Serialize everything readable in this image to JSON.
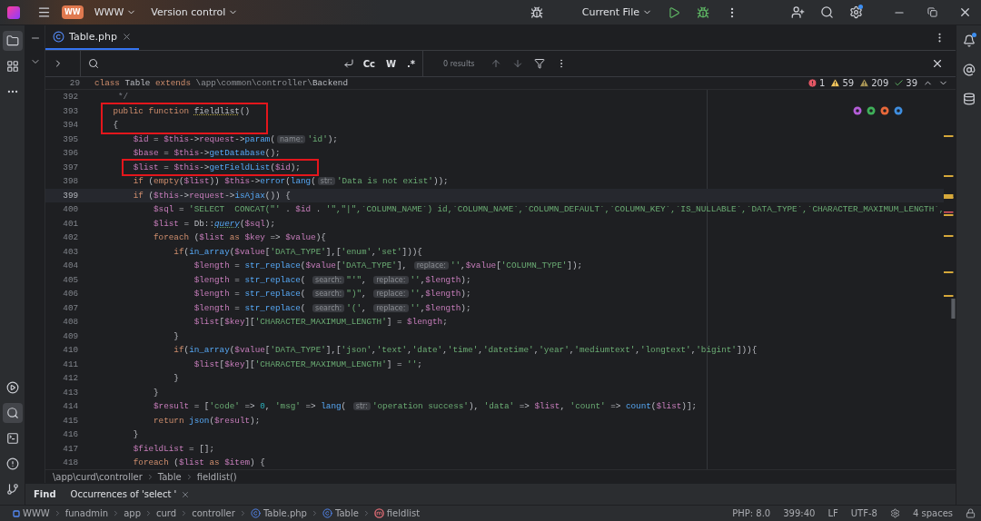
{
  "title_bar": {
    "project_badge": "WW",
    "project": "WWW",
    "vcs": "Version control",
    "run_config": "Current File"
  },
  "left_tools": [
    {
      "kind": "project",
      "selected": true
    },
    {
      "kind": "structure",
      "selected": false
    },
    {
      "kind": "more",
      "selected": false
    }
  ],
  "left_tools_bottom": [
    {
      "kind": "services",
      "selected": false
    },
    {
      "kind": "find",
      "selected": true
    },
    {
      "kind": "terminal",
      "selected": false
    },
    {
      "kind": "problems",
      "selected": false
    },
    {
      "kind": "git",
      "selected": false
    }
  ],
  "tabs": [
    {
      "label": "Table.php",
      "selected": true
    }
  ],
  "find_bar": {
    "toggles": [
      "Cc",
      "W",
      ".*"
    ],
    "results": "0 results"
  },
  "sticky_line": {
    "number": "29",
    "tokens": [
      {
        "kind": "keyword",
        "text": "class "
      },
      {
        "kind": "plain",
        "text": "Table "
      },
      {
        "kind": "keyword",
        "text": "extends "
      },
      {
        "kind": "namespace",
        "text": "\\app\\common\\controller\\"
      },
      {
        "kind": "plain",
        "text": "Backend"
      }
    ]
  },
  "inspections": [
    {
      "kind": "error",
      "count": "1"
    },
    {
      "kind": "warning",
      "count": "59"
    },
    {
      "kind": "weak_warning",
      "count": "209"
    },
    {
      "kind": "typo",
      "count": "39"
    }
  ],
  "lines": [
    {
      "number": "392",
      "current": false,
      "boxed": false,
      "tokens": [
        {
          "kind": "comment",
          "text": "     */"
        }
      ]
    },
    {
      "number": "393",
      "current": false,
      "boxed": true,
      "tokens": [
        {
          "kind": "keyword",
          "text": "    public function "
        },
        {
          "kind": "declaration",
          "text": "fieldlist"
        },
        {
          "kind": "plain",
          "text": "()"
        }
      ]
    },
    {
      "number": "394",
      "current": false,
      "boxed": true,
      "tokens": [
        {
          "kind": "plain",
          "text": "    {"
        }
      ]
    },
    {
      "number": "395",
      "current": false,
      "boxed": false,
      "tokens": [
        {
          "kind": "variable",
          "text": "        $id"
        },
        {
          "kind": "plain",
          "text": " = "
        },
        {
          "kind": "variable",
          "text": "$this"
        },
        {
          "kind": "plain",
          "text": "->"
        },
        {
          "kind": "variable",
          "text": "request"
        },
        {
          "kind": "plain",
          "text": "->"
        },
        {
          "kind": "function",
          "text": "param"
        },
        {
          "kind": "plain",
          "text": "("
        },
        {
          "kind": "hint",
          "text": "name:"
        },
        {
          "kind": "string",
          "text": "'id'"
        },
        {
          "kind": "plain",
          "text": ");"
        }
      ]
    },
    {
      "number": "396",
      "current": false,
      "boxed": false,
      "tokens": [
        {
          "kind": "variable",
          "text": "        $base"
        },
        {
          "kind": "plain",
          "text": " = "
        },
        {
          "kind": "variable",
          "text": "$this"
        },
        {
          "kind": "plain",
          "text": "->"
        },
        {
          "kind": "function",
          "text": "getDatabase"
        },
        {
          "kind": "plain",
          "text": "();"
        }
      ]
    },
    {
      "number": "397",
      "current": false,
      "boxed": true,
      "tokens": [
        {
          "kind": "variable",
          "text": "        $list"
        },
        {
          "kind": "plain",
          "text": " = "
        },
        {
          "kind": "variable",
          "text": "$this"
        },
        {
          "kind": "plain",
          "text": "->"
        },
        {
          "kind": "function",
          "text": "getFieldList"
        },
        {
          "kind": "plain",
          "text": "("
        },
        {
          "kind": "variable",
          "text": "$id"
        },
        {
          "kind": "plain",
          "text": ");"
        }
      ]
    },
    {
      "number": "398",
      "current": false,
      "boxed": false,
      "tokens": [
        {
          "kind": "keyword",
          "text": "        if "
        },
        {
          "kind": "plain",
          "text": "("
        },
        {
          "kind": "keyword",
          "text": "empty"
        },
        {
          "kind": "plain",
          "text": "("
        },
        {
          "kind": "variable",
          "text": "$list"
        },
        {
          "kind": "plain",
          "text": ")) "
        },
        {
          "kind": "variable",
          "text": "$this"
        },
        {
          "kind": "plain",
          "text": "->"
        },
        {
          "kind": "function",
          "text": "error"
        },
        {
          "kind": "plain",
          "text": "("
        },
        {
          "kind": "function",
          "text": "lang"
        },
        {
          "kind": "plain",
          "text": "("
        },
        {
          "kind": "hint",
          "text": "str:"
        },
        {
          "kind": "string",
          "text": "'Data is not exist'"
        },
        {
          "kind": "plain",
          "text": "));"
        }
      ]
    },
    {
      "number": "399",
      "current": true,
      "boxed": false,
      "tokens": [
        {
          "kind": "keyword",
          "text": "        if "
        },
        {
          "kind": "plain",
          "text": "("
        },
        {
          "kind": "variable",
          "text": "$this"
        },
        {
          "kind": "plain",
          "text": "->"
        },
        {
          "kind": "variable",
          "text": "request"
        },
        {
          "kind": "plain",
          "text": "->"
        },
        {
          "kind": "function",
          "text": "isAjax"
        },
        {
          "kind": "plain",
          "text": "()) {"
        }
      ]
    },
    {
      "number": "400",
      "current": false,
      "boxed": false,
      "tokens": [
        {
          "kind": "variable",
          "text": "            $sql"
        },
        {
          "kind": "plain",
          "text": " = "
        },
        {
          "kind": "string",
          "text": "'SELECT  CONCAT(\"'"
        },
        {
          "kind": "plain",
          "text": " . "
        },
        {
          "kind": "variable",
          "text": "$id"
        },
        {
          "kind": "plain",
          "text": " . "
        },
        {
          "kind": "string",
          "text": "'\",\"|\",`COLUMN_NAME`) id,`COLUMN_NAME`,`COLUMN_DEFAULT`,`COLUMN_KEY`,`IS_NULLABLE`,`DATA_TYPE`,`CHARACTER_MAXIMUM_LENGTH`,"
        }
      ]
    },
    {
      "number": "401",
      "current": false,
      "boxed": false,
      "tokens": [
        {
          "kind": "variable",
          "text": "            $list"
        },
        {
          "kind": "plain",
          "text": " = Db::"
        },
        {
          "kind": "italic_function",
          "text": "query"
        },
        {
          "kind": "plain",
          "text": "("
        },
        {
          "kind": "variable",
          "text": "$sql"
        },
        {
          "kind": "plain",
          "text": ");"
        }
      ]
    },
    {
      "number": "402",
      "current": false,
      "boxed": false,
      "tokens": [
        {
          "kind": "keyword",
          "text": "            foreach "
        },
        {
          "kind": "plain",
          "text": "("
        },
        {
          "kind": "variable",
          "text": "$list"
        },
        {
          "kind": "keyword",
          "text": " as "
        },
        {
          "kind": "variable",
          "text": "$key"
        },
        {
          "kind": "plain",
          "text": " => "
        },
        {
          "kind": "variable",
          "text": "$value"
        },
        {
          "kind": "plain",
          "text": "){"
        }
      ]
    },
    {
      "number": "403",
      "current": false,
      "boxed": false,
      "tokens": [
        {
          "kind": "keyword",
          "text": "                if"
        },
        {
          "kind": "plain",
          "text": "("
        },
        {
          "kind": "function",
          "text": "in_array"
        },
        {
          "kind": "plain",
          "text": "("
        },
        {
          "kind": "variable",
          "text": "$value"
        },
        {
          "kind": "plain",
          "text": "["
        },
        {
          "kind": "string",
          "text": "'DATA_TYPE'"
        },
        {
          "kind": "plain",
          "text": "],["
        },
        {
          "kind": "string",
          "text": "'enum'"
        },
        {
          "kind": "plain",
          "text": ","
        },
        {
          "kind": "string",
          "text": "'set'"
        },
        {
          "kind": "plain",
          "text": "])){"
        }
      ]
    },
    {
      "number": "404",
      "current": false,
      "boxed": false,
      "tokens": [
        {
          "kind": "variable",
          "text": "                    $length"
        },
        {
          "kind": "plain",
          "text": " = "
        },
        {
          "kind": "function",
          "text": "str_replace"
        },
        {
          "kind": "plain",
          "text": "("
        },
        {
          "kind": "variable",
          "text": "$value"
        },
        {
          "kind": "plain",
          "text": "["
        },
        {
          "kind": "string",
          "text": "'DATA_TYPE'"
        },
        {
          "kind": "plain",
          "text": "], "
        },
        {
          "kind": "hint",
          "text": "replace:"
        },
        {
          "kind": "string",
          "text": "''"
        },
        {
          "kind": "plain",
          "text": ","
        },
        {
          "kind": "variable",
          "text": "$value"
        },
        {
          "kind": "plain",
          "text": "["
        },
        {
          "kind": "string",
          "text": "'COLUMN_TYPE'"
        },
        {
          "kind": "plain",
          "text": "]);"
        }
      ]
    },
    {
      "number": "405",
      "current": false,
      "boxed": false,
      "tokens": [
        {
          "kind": "variable",
          "text": "                    $length"
        },
        {
          "kind": "plain",
          "text": " = "
        },
        {
          "kind": "function",
          "text": "str_replace"
        },
        {
          "kind": "plain",
          "text": "( "
        },
        {
          "kind": "hint",
          "text": "search:"
        },
        {
          "kind": "string",
          "text": "\"'\""
        },
        {
          "kind": "plain",
          "text": ", "
        },
        {
          "kind": "hint",
          "text": "replace:"
        },
        {
          "kind": "string",
          "text": "''"
        },
        {
          "kind": "plain",
          "text": ","
        },
        {
          "kind": "variable",
          "text": "$length"
        },
        {
          "kind": "plain",
          "text": ");"
        }
      ]
    },
    {
      "number": "406",
      "current": false,
      "boxed": false,
      "tokens": [
        {
          "kind": "variable",
          "text": "                    $length"
        },
        {
          "kind": "plain",
          "text": " = "
        },
        {
          "kind": "function",
          "text": "str_replace"
        },
        {
          "kind": "plain",
          "text": "( "
        },
        {
          "kind": "hint",
          "text": "search:"
        },
        {
          "kind": "string",
          "text": "\")\""
        },
        {
          "kind": "plain",
          "text": ", "
        },
        {
          "kind": "hint",
          "text": "replace:"
        },
        {
          "kind": "string",
          "text": "''"
        },
        {
          "kind": "plain",
          "text": ","
        },
        {
          "kind": "variable",
          "text": "$length"
        },
        {
          "kind": "plain",
          "text": ");"
        }
      ]
    },
    {
      "number": "407",
      "current": false,
      "boxed": false,
      "tokens": [
        {
          "kind": "variable",
          "text": "                    $length"
        },
        {
          "kind": "plain",
          "text": " = "
        },
        {
          "kind": "function",
          "text": "str_replace"
        },
        {
          "kind": "plain",
          "text": "( "
        },
        {
          "kind": "hint",
          "text": "search:"
        },
        {
          "kind": "string",
          "text": "'('"
        },
        {
          "kind": "plain",
          "text": ", "
        },
        {
          "kind": "hint",
          "text": "replace:"
        },
        {
          "kind": "string",
          "text": "''"
        },
        {
          "kind": "plain",
          "text": ","
        },
        {
          "kind": "variable",
          "text": "$length"
        },
        {
          "kind": "plain",
          "text": ");"
        }
      ]
    },
    {
      "number": "408",
      "current": false,
      "boxed": false,
      "tokens": [
        {
          "kind": "variable",
          "text": "                    $list"
        },
        {
          "kind": "plain",
          "text": "["
        },
        {
          "kind": "variable",
          "text": "$key"
        },
        {
          "kind": "plain",
          "text": "]["
        },
        {
          "kind": "string",
          "text": "'CHARACTER_MAXIMUM_LENGTH'"
        },
        {
          "kind": "plain",
          "text": "] = "
        },
        {
          "kind": "variable",
          "text": "$length"
        },
        {
          "kind": "plain",
          "text": ";"
        }
      ]
    },
    {
      "number": "409",
      "current": false,
      "boxed": false,
      "tokens": [
        {
          "kind": "plain",
          "text": "                }"
        }
      ]
    },
    {
      "number": "410",
      "current": false,
      "boxed": false,
      "tokens": [
        {
          "kind": "keyword",
          "text": "                if"
        },
        {
          "kind": "plain",
          "text": "("
        },
        {
          "kind": "function",
          "text": "in_array"
        },
        {
          "kind": "plain",
          "text": "("
        },
        {
          "kind": "variable",
          "text": "$value"
        },
        {
          "kind": "plain",
          "text": "["
        },
        {
          "kind": "string",
          "text": "'DATA_TYPE'"
        },
        {
          "kind": "plain",
          "text": "],["
        },
        {
          "kind": "string",
          "text": "'json'"
        },
        {
          "kind": "plain",
          "text": ","
        },
        {
          "kind": "string",
          "text": "'text'"
        },
        {
          "kind": "plain",
          "text": ","
        },
        {
          "kind": "string",
          "text": "'date'"
        },
        {
          "kind": "plain",
          "text": ","
        },
        {
          "kind": "string",
          "text": "'time'"
        },
        {
          "kind": "plain",
          "text": ","
        },
        {
          "kind": "string",
          "text": "'datetime'"
        },
        {
          "kind": "plain",
          "text": ","
        },
        {
          "kind": "string",
          "text": "'year'"
        },
        {
          "kind": "plain",
          "text": ","
        },
        {
          "kind": "string",
          "text": "'mediumtext'"
        },
        {
          "kind": "plain",
          "text": ","
        },
        {
          "kind": "string",
          "text": "'longtext'"
        },
        {
          "kind": "plain",
          "text": ","
        },
        {
          "kind": "string",
          "text": "'bigint'"
        },
        {
          "kind": "plain",
          "text": "])){"
        }
      ]
    },
    {
      "number": "411",
      "current": false,
      "boxed": false,
      "tokens": [
        {
          "kind": "variable",
          "text": "                    $list"
        },
        {
          "kind": "plain",
          "text": "["
        },
        {
          "kind": "variable",
          "text": "$key"
        },
        {
          "kind": "plain",
          "text": "]["
        },
        {
          "kind": "string",
          "text": "'CHARACTER_MAXIMUM_LENGTH'"
        },
        {
          "kind": "plain",
          "text": "] = "
        },
        {
          "kind": "string",
          "text": "''"
        },
        {
          "kind": "plain",
          "text": ";"
        }
      ]
    },
    {
      "number": "412",
      "current": false,
      "boxed": false,
      "tokens": [
        {
          "kind": "plain",
          "text": "                }"
        }
      ]
    },
    {
      "number": "413",
      "current": false,
      "boxed": false,
      "tokens": [
        {
          "kind": "plain",
          "text": "            }"
        }
      ]
    },
    {
      "number": "414",
      "current": false,
      "boxed": false,
      "tokens": [
        {
          "kind": "variable",
          "text": "            $result"
        },
        {
          "kind": "plain",
          "text": " = ["
        },
        {
          "kind": "string",
          "text": "'code'"
        },
        {
          "kind": "plain",
          "text": " => "
        },
        {
          "kind": "number",
          "text": "0"
        },
        {
          "kind": "plain",
          "text": ", "
        },
        {
          "kind": "string",
          "text": "'msg'"
        },
        {
          "kind": "plain",
          "text": " => "
        },
        {
          "kind": "function",
          "text": "lang"
        },
        {
          "kind": "plain",
          "text": "( "
        },
        {
          "kind": "hint",
          "text": "str:"
        },
        {
          "kind": "string",
          "text": "'operation success'"
        },
        {
          "kind": "plain",
          "text": "), "
        },
        {
          "kind": "string",
          "text": "'data'"
        },
        {
          "kind": "plain",
          "text": " => "
        },
        {
          "kind": "variable",
          "text": "$list"
        },
        {
          "kind": "plain",
          "text": ", "
        },
        {
          "kind": "string",
          "text": "'count'"
        },
        {
          "kind": "plain",
          "text": " => "
        },
        {
          "kind": "function",
          "text": "count"
        },
        {
          "kind": "plain",
          "text": "("
        },
        {
          "kind": "variable",
          "text": "$list"
        },
        {
          "kind": "plain",
          "text": ")];"
        }
      ]
    },
    {
      "number": "415",
      "current": false,
      "boxed": false,
      "tokens": [
        {
          "kind": "keyword",
          "text": "            return "
        },
        {
          "kind": "function",
          "text": "json"
        },
        {
          "kind": "plain",
          "text": "("
        },
        {
          "kind": "variable",
          "text": "$result"
        },
        {
          "kind": "plain",
          "text": ");"
        }
      ]
    },
    {
      "number": "416",
      "current": false,
      "boxed": false,
      "tokens": [
        {
          "kind": "plain",
          "text": "        }"
        }
      ]
    },
    {
      "number": "417",
      "current": false,
      "boxed": false,
      "tokens": [
        {
          "kind": "variable",
          "text": "        $fieldList"
        },
        {
          "kind": "plain",
          "text": " = [];"
        }
      ]
    },
    {
      "number": "418",
      "current": false,
      "boxed": false,
      "tokens": [
        {
          "kind": "keyword",
          "text": "        foreach "
        },
        {
          "kind": "plain",
          "text": "("
        },
        {
          "kind": "variable",
          "text": "$list"
        },
        {
          "kind": "keyword",
          "text": " as "
        },
        {
          "kind": "variable",
          "text": "$item"
        },
        {
          "kind": "plain",
          "text": ") {"
        }
      ]
    }
  ],
  "breadcrumbs": [
    "\\app\\curd\\controller",
    "Table",
    "fieldlist()"
  ],
  "tool_window": {
    "title": "Find",
    "tab": "Occurrences of 'select '"
  },
  "status_bar": {
    "path": [
      {
        "kind": "project",
        "label": "WWW"
      },
      {
        "kind": "folder",
        "label": "funadmin"
      },
      {
        "kind": "folder",
        "label": "app"
      },
      {
        "kind": "folder",
        "label": "curd"
      },
      {
        "kind": "folder",
        "label": "controller"
      },
      {
        "kind": "file",
        "label": "Table.php"
      },
      {
        "kind": "class",
        "label": "Table"
      },
      {
        "kind": "method",
        "label": "fieldlist"
      }
    ],
    "items": [
      "PHP: 8.0",
      "399:40",
      "LF",
      "UTF-8"
    ],
    "indent": "4 spaces"
  }
}
